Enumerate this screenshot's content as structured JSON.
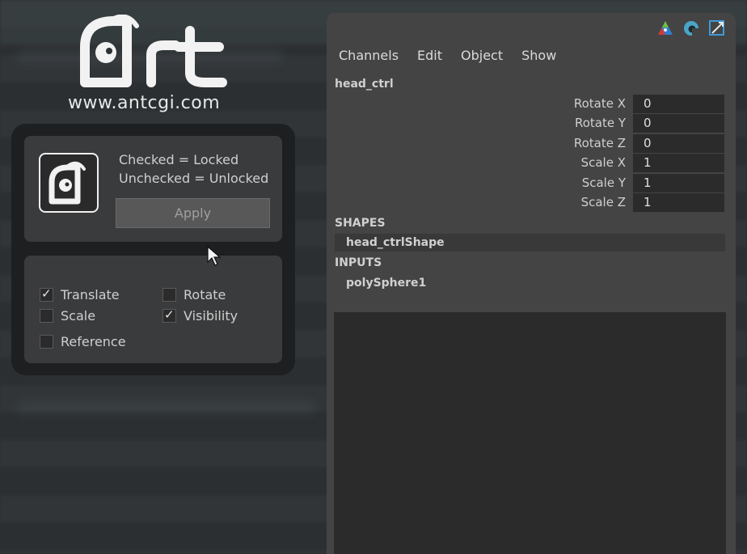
{
  "brand": {
    "logo_text": "Art",
    "website": "www.antcgi.com"
  },
  "lock_tool": {
    "legend_checked": "Checked = Locked",
    "legend_unchecked": "Unchecked = Unlocked",
    "apply_label": "Apply",
    "options": [
      {
        "label": "Translate",
        "checked": true
      },
      {
        "label": "Rotate",
        "checked": false
      },
      {
        "label": "Scale",
        "checked": false
      },
      {
        "label": "Visibility",
        "checked": true
      },
      {
        "label": "Reference",
        "checked": false
      }
    ],
    "check_glyph": "✓"
  },
  "channel_box": {
    "toolbar_icons": [
      "channel-box-icon",
      "attribute-editor-icon",
      "tool-settings-icon"
    ],
    "menu": [
      "Channels",
      "Edit",
      "Object",
      "Show"
    ],
    "object_name": "head_ctrl",
    "attributes": [
      {
        "label": "Rotate X",
        "value": "0"
      },
      {
        "label": "Rotate Y",
        "value": "0"
      },
      {
        "label": "Rotate Z",
        "value": "0"
      },
      {
        "label": "Scale X",
        "value": "1"
      },
      {
        "label": "Scale Y",
        "value": "1"
      },
      {
        "label": "Scale Z",
        "value": "1"
      }
    ],
    "shapes_header": "SHAPES",
    "shape_node": "head_ctrlShape",
    "inputs_header": "INPUTS",
    "input_node": "polySphere1"
  },
  "colors": {
    "background": "#2d3133",
    "panel": "#3a3b3c",
    "channel_box": "#444444",
    "field": "#2b2b2b"
  }
}
